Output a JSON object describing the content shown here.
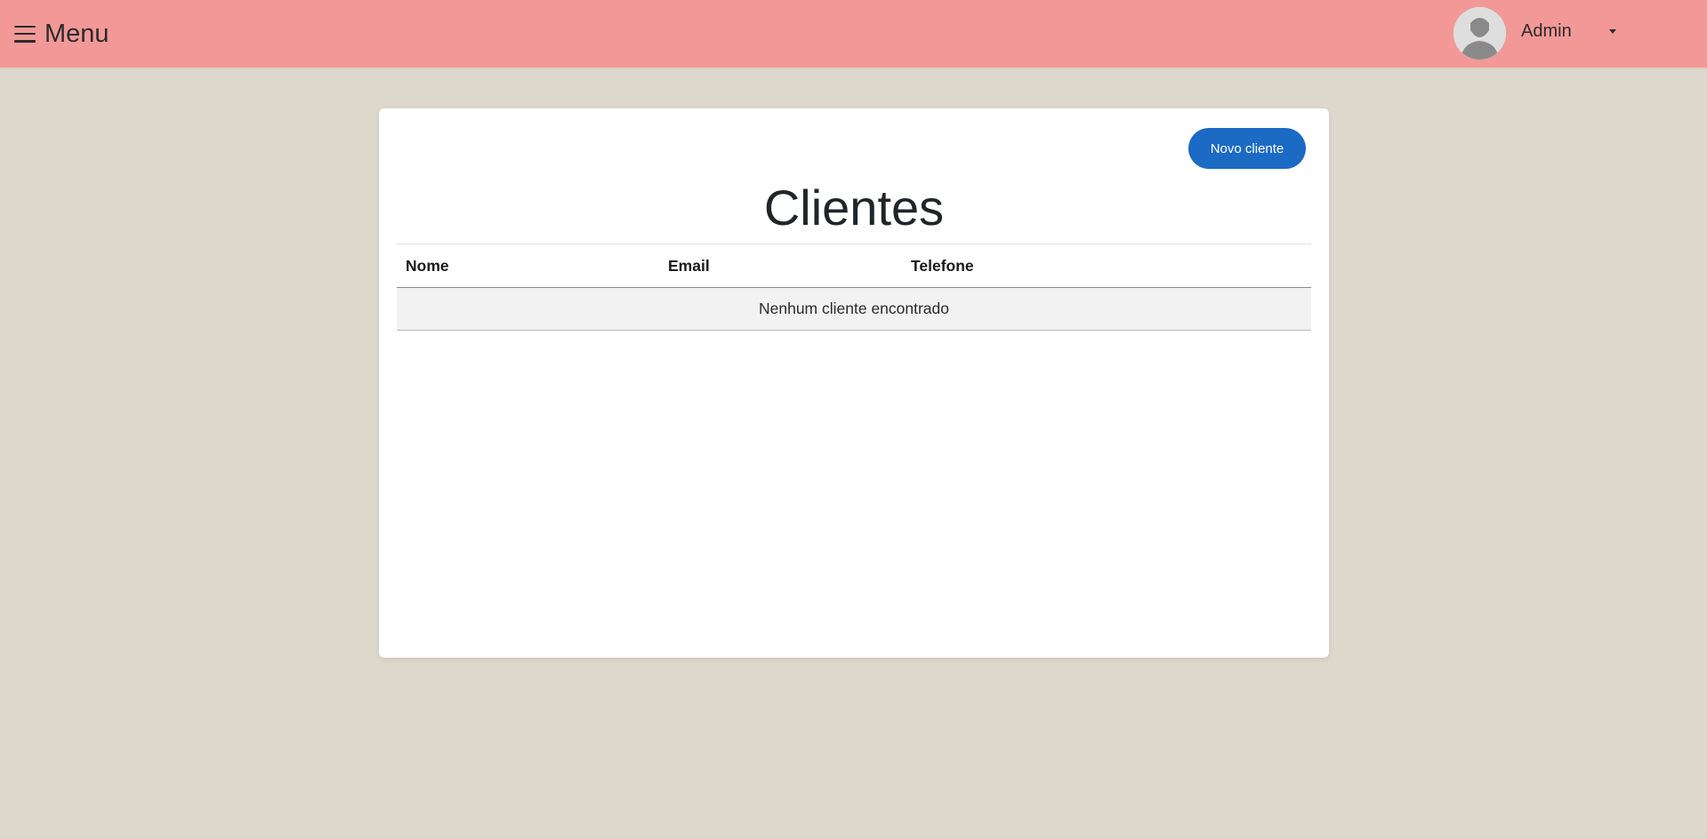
{
  "navbar": {
    "menu_label": "Menu",
    "user_name": "Admin"
  },
  "icons": {
    "menu": "hamburger-icon",
    "user": "avatar-icon",
    "dropdown": "caret-down-icon"
  },
  "colors": {
    "navbar_bg": "#f29997",
    "page_bg": "#dcd8cc",
    "primary_button": "#1b6ac4"
  },
  "page": {
    "title": "Clientes",
    "new_button_label": "Novo cliente"
  },
  "table": {
    "columns": [
      "Nome",
      "Email",
      "Telefone"
    ],
    "empty_message": "Nenhum cliente encontrado"
  }
}
